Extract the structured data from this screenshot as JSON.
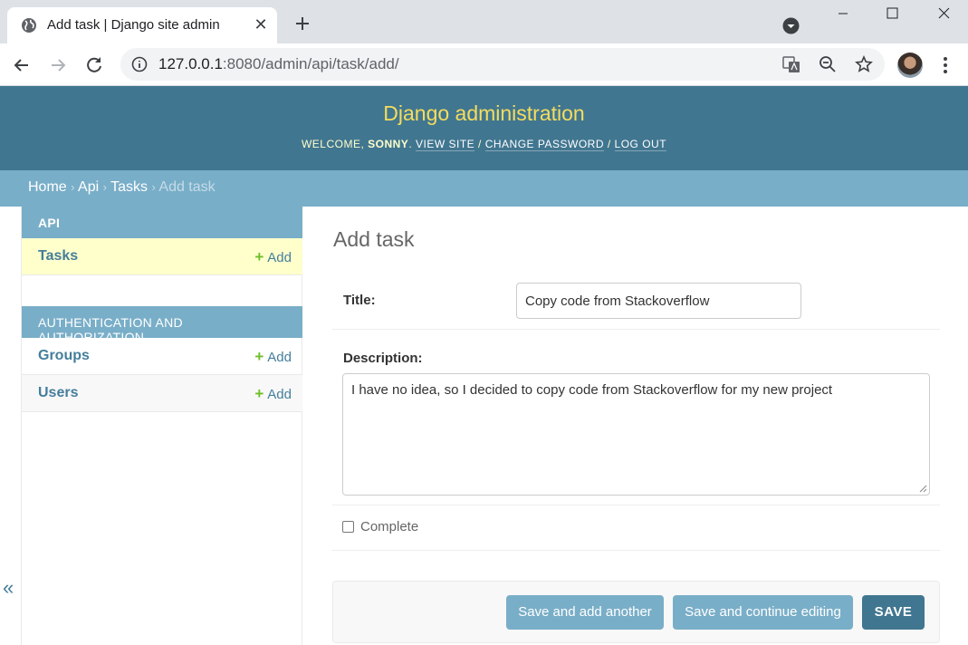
{
  "browser": {
    "tab_title": "Add task | Django site admin",
    "url_host": "127.0.0.1",
    "url_rest": ":8080/admin/api/task/add/",
    "tab_close_glyph": "✕"
  },
  "header": {
    "site_name": "Django administration",
    "welcome": "WELCOME,",
    "username": "SONNY",
    "view_site": "VIEW SITE",
    "change_password": "CHANGE PASSWORD",
    "log_out": "LOG OUT"
  },
  "breadcrumbs": {
    "home": "Home",
    "api": "Api",
    "tasks": "Tasks",
    "current": "Add task",
    "separator": "›"
  },
  "sidebar": {
    "modules": [
      {
        "caption": "API",
        "models": [
          {
            "name": "Tasks",
            "add_label": "Add",
            "current": true
          }
        ]
      },
      {
        "caption": "AUTHENTICATION AND AUTHORIZATION",
        "models": [
          {
            "name": "Groups",
            "add_label": "Add"
          },
          {
            "name": "Users",
            "add_label": "Add"
          }
        ]
      }
    ],
    "toggle_glyph": "«",
    "plus_glyph": "+"
  },
  "form": {
    "page_title": "Add task",
    "title_label": "Title:",
    "title_value": "Copy code from Stackoverflow",
    "description_label": "Description:",
    "description_value": "I have no idea, so I decided to copy code from Stackoverflow for my new project",
    "complete_label": "Complete",
    "complete_checked": false
  },
  "submit": {
    "save_add_another": "Save and add another",
    "save_continue": "Save and continue editing",
    "save": "SAVE"
  },
  "colors": {
    "header_bg": "#417690",
    "accent": "#79aec8",
    "site_name": "#f5dd5d",
    "link": "#447e9b",
    "add_plus": "#70bf2b"
  }
}
